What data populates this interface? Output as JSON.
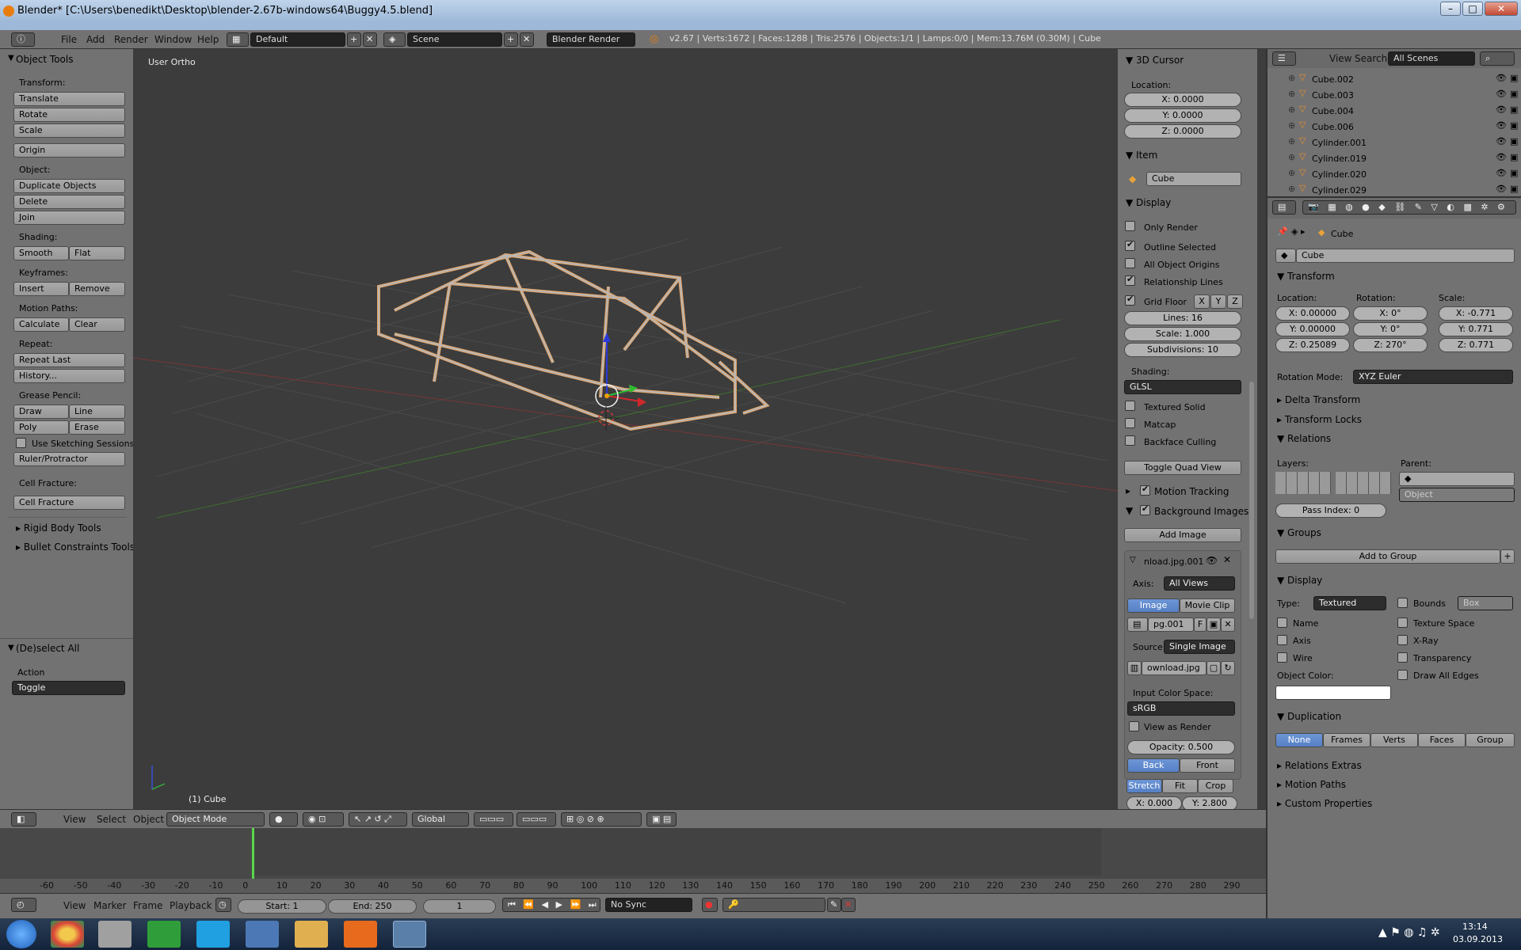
{
  "window": {
    "title": "Blender* [C:\\Users\\benedikt\\Desktop\\blender-2.67b-windows64\\Buggy4.5.blend]"
  },
  "info_header": {
    "menus": [
      "File",
      "Add",
      "Render",
      "Window",
      "Help"
    ],
    "layout": "Default",
    "scene": "Scene",
    "engine": "Blender Render",
    "stats": "v2.67 | Verts:1672 | Faces:1288 | Tris:2576 | Objects:1/1 | Lamps:0/0 | Mem:13.76M (0.30M) | Cube"
  },
  "tools": {
    "title": "Object Tools",
    "transform_label": "Transform:",
    "translate": "Translate",
    "rotate": "Rotate",
    "scale": "Scale",
    "origin": "Origin",
    "object_label": "Object:",
    "duplicate": "Duplicate Objects",
    "delete": "Delete",
    "join": "Join",
    "shading_label": "Shading:",
    "smooth": "Smooth",
    "flat": "Flat",
    "keyframes_label": "Keyframes:",
    "insert": "Insert",
    "remove": "Remove",
    "motion_label": "Motion Paths:",
    "calculate": "Calculate",
    "clear": "Clear",
    "repeat_label": "Repeat:",
    "repeat_last": "Repeat Last",
    "history": "History...",
    "grease_label": "Grease Pencil:",
    "draw": "Draw",
    "line": "Line",
    "poly": "Poly",
    "erase": "Erase",
    "sketching": "Use Sketching Sessions",
    "ruler": "Ruler/Protractor",
    "cell_label": "Cell Fracture:",
    "cell_btn": "Cell Fracture",
    "rigid": "Rigid Body Tools",
    "bullet": "Bullet Constraints Tools",
    "deselect_title": "(De)select All",
    "action_label": "Action",
    "action_value": "Toggle"
  },
  "viewport": {
    "view_label": "User Ortho",
    "object_label": "(1) Cube"
  },
  "view_header": {
    "menus": [
      "View",
      "Select",
      "Object"
    ],
    "mode": "Object Mode",
    "orientation": "Global"
  },
  "properties_n": {
    "cursor_title": "3D Cursor",
    "location_label": "Location:",
    "cx": "X: 0.0000",
    "cy": "Y: 0.0000",
    "cz": "Z: 0.0000",
    "item_title": "Item",
    "item_name": "Cube",
    "display_title": "Display",
    "only_render": "Only Render",
    "outline_selected": "Outline Selected",
    "all_origins": "All Object Origins",
    "relationship": "Relationship Lines",
    "grid_floor": "Grid Floor",
    "gx": "X",
    "gy": "Y",
    "gz": "Z",
    "lines": "Lines: 16",
    "grid_scale": "Scale: 1.000",
    "subdiv": "Subdivisions: 10",
    "shading_label": "Shading:",
    "shading_value": "GLSL",
    "textured_solid": "Textured Solid",
    "matcap": "Matcap",
    "backface": "Backface Culling",
    "toggle_quad": "Toggle Quad View",
    "motion_tracking": "Motion Tracking",
    "bg_images": "Background Images",
    "add_image": "Add Image",
    "img_name": "nload.jpg.001",
    "axis_label": "Axis:",
    "axis_value": "All Views",
    "tab_image": "Image",
    "tab_clip": "Movie Clip",
    "img_slot": "pg.001",
    "img_f": "F",
    "source_label": "Source",
    "source_value": "Single Image",
    "file": "ownload.jpg",
    "ics_label": "Input Color Space:",
    "ics_value": "sRGB",
    "view_render": "View as Render",
    "opacity": "Opacity: 0.500",
    "back": "Back",
    "front": "Front",
    "stretch": "Stretch",
    "fit": "Fit",
    "crop": "Crop",
    "ox": "X: 0.000",
    "oy": "Y: 2.800"
  },
  "outliner": {
    "menus": [
      "View",
      "Search"
    ],
    "filter": "All Scenes",
    "items": [
      "Cube.002",
      "Cube.003",
      "Cube.004",
      "Cube.006",
      "Cylinder.001",
      "Cylinder.019",
      "Cylinder.020",
      "Cylinder.029"
    ]
  },
  "object_props": {
    "breadcrumb": "Cube",
    "name": "Cube",
    "transform_title": "Transform",
    "location_label": "Location:",
    "rotation_label": "Rotation:",
    "scale_label": "Scale:",
    "lx": "X: 0.00000",
    "ly": "Y: 0.00000",
    "lz": "Z: 0.25089",
    "rx": "X: 0°",
    "ry": "Y: 0°",
    "rz": "Z: 270°",
    "sx": "X: -0.771",
    "sy": "Y: 0.771",
    "sz": "Z: 0.771",
    "rotmode_label": "Rotation Mode:",
    "rotmode": "XYZ Euler",
    "delta": "Delta Transform",
    "locks": "Transform Locks",
    "relations": "Relations",
    "layers_label": "Layers:",
    "parent_label": "Parent:",
    "parent_type": "Object",
    "pass_index": "Pass Index: 0",
    "groups": "Groups",
    "add_group": "Add to Group",
    "display": "Display",
    "type_label": "Type:",
    "type_value": "Textured",
    "bounds": "Bounds",
    "bounds_type": "Box",
    "name_chk": "Name",
    "texture_space": "Texture Space",
    "axis": "Axis",
    "xray": "X-Ray",
    "wire": "Wire",
    "transparency": "Transparency",
    "obj_color": "Object Color:",
    "draw_edges": "Draw All Edges",
    "duplication": "Duplication",
    "dup_none": "None",
    "dup_frames": "Frames",
    "dup_verts": "Verts",
    "dup_faces": "Faces",
    "dup_group": "Group",
    "rel_extras": "Relations Extras",
    "motion_paths": "Motion Paths",
    "custom_props": "Custom Properties"
  },
  "timeline": {
    "ticks": [
      "-60",
      "-50",
      "-40",
      "-30",
      "-20",
      "-10",
      "0",
      "10",
      "20",
      "30",
      "40",
      "50",
      "60",
      "70",
      "80",
      "90",
      "100",
      "110",
      "120",
      "130",
      "140",
      "150",
      "160",
      "170",
      "180",
      "190",
      "200",
      "210",
      "220",
      "230",
      "240",
      "250",
      "260",
      "270",
      "280",
      "290"
    ],
    "menus": [
      "View",
      "Marker",
      "Frame",
      "Playback"
    ],
    "start": "Start: 1",
    "end": "End: 250",
    "current": "1",
    "sync": "No Sync"
  },
  "taskbar": {
    "time": "13:14",
    "date": "03.09.2013"
  }
}
